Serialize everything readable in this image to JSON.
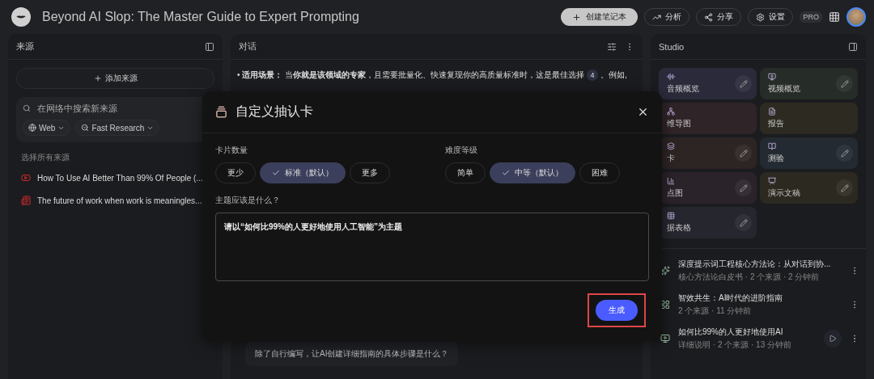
{
  "header": {
    "title": "Beyond AI Slop: The Master Guide to Expert Prompting",
    "create_button": "创建笔记本",
    "actions": [
      {
        "kind": "analytics",
        "label": "分析"
      },
      {
        "kind": "share",
        "label": "分享"
      },
      {
        "kind": "settings",
        "label": "设置"
      }
    ],
    "badge": "PRO"
  },
  "sources": {
    "title": "来源",
    "add_button": "添加来源",
    "search": {
      "placeholder": "在网络中搜索新来源",
      "chips": [
        {
          "kind": "web",
          "label": "Web"
        },
        {
          "kind": "research",
          "label": "Fast Research"
        }
      ]
    },
    "select_all": "选择所有来源",
    "items": [
      {
        "kind": "video",
        "title": "How To Use AI Better Than 99% Of People (..."
      },
      {
        "kind": "article",
        "title": "The future of work when work is meaningles..."
      }
    ]
  },
  "chat": {
    "title": "对话",
    "bullet": {
      "marker": "•",
      "before": "**适用场景：** 当**你就是该领域的专家**，且需要批量化、快速复现你的高质量标准时，这是最佳选择",
      "citation": "4",
      "after": "。例如,"
    },
    "suggestion": "除了自行编写，让AI创建详细指南的具体步骤是什么？"
  },
  "studio": {
    "title": "Studio",
    "tiles": [
      {
        "kind": "audio",
        "label": "音频概览",
        "color": "#2a2a3b",
        "editable": true
      },
      {
        "kind": "video",
        "label": "视频概览",
        "color": "#262c27",
        "editable": true
      },
      {
        "kind": "mindmap",
        "label": "维导图",
        "color": "#2f2428",
        "editable": false
      },
      {
        "kind": "report",
        "label": "报告",
        "color": "#2d2b21",
        "editable": false
      },
      {
        "kind": "cards",
        "label": "卡",
        "color": "#2d2424",
        "editable": true
      },
      {
        "kind": "quiz",
        "label": "测验",
        "color": "#242a31",
        "editable": true
      },
      {
        "kind": "infographic",
        "label": "点图",
        "color": "#2a2329",
        "editable": true
      },
      {
        "kind": "slides",
        "label": "演示文稿",
        "color": "#2c2a20",
        "editable": true
      },
      {
        "kind": "table",
        "label": "据表格",
        "color": "#26262f",
        "editable": true
      }
    ],
    "notes": [
      {
        "kind": "spark",
        "title": "深度提示词工程核心方法论：从对话到协...",
        "meta": "核心方法论白皮书 · 2 个来源 · 2 分钟前",
        "playable": false
      },
      {
        "kind": "grid",
        "title": "智效共生：AI时代的进阶指南",
        "meta": "2 个来源 · 11 分钟前",
        "playable": false
      },
      {
        "kind": "video",
        "title": "如何比99%的人更好地使用AI",
        "meta": "详细说明 · 2 个来源 · 13 分钟前",
        "playable": true
      }
    ]
  },
  "dialog": {
    "title": "自定义抽认卡",
    "groups": [
      {
        "label": "卡片数量",
        "options": [
          {
            "label": "更少",
            "selected": false
          },
          {
            "label": "标准（默认）",
            "selected": true
          },
          {
            "label": "更多",
            "selected": false
          }
        ]
      },
      {
        "label": "难度等级",
        "options": [
          {
            "label": "简单",
            "selected": false
          },
          {
            "label": "中等（默认）",
            "selected": true
          },
          {
            "label": "困难",
            "selected": false
          }
        ]
      }
    ],
    "prompt_label": "主题应该是什么？",
    "prompt_value": "请以“如何比99%的人更好地使用人工智能”为主题",
    "generate_button": "生成",
    "highlighted": true
  }
}
